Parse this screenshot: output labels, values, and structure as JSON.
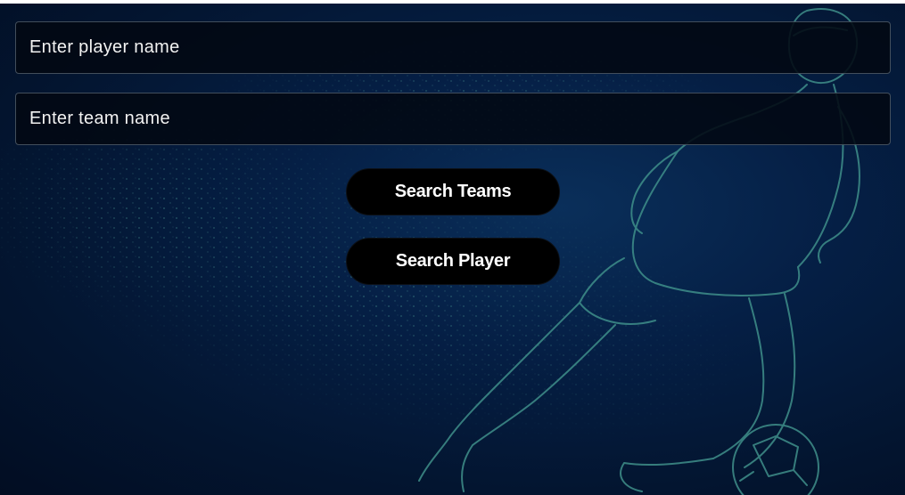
{
  "form": {
    "player_placeholder": "Enter player name",
    "player_value": "",
    "team_placeholder": "Enter team name",
    "team_value": ""
  },
  "actions": {
    "search_teams_label": "Search Teams",
    "search_player_label": "Search Player"
  },
  "background": {
    "description_icon": "soccer-player-sketch-icon",
    "accent_color": "#3f8f8a",
    "base_color": "#041a3a"
  }
}
